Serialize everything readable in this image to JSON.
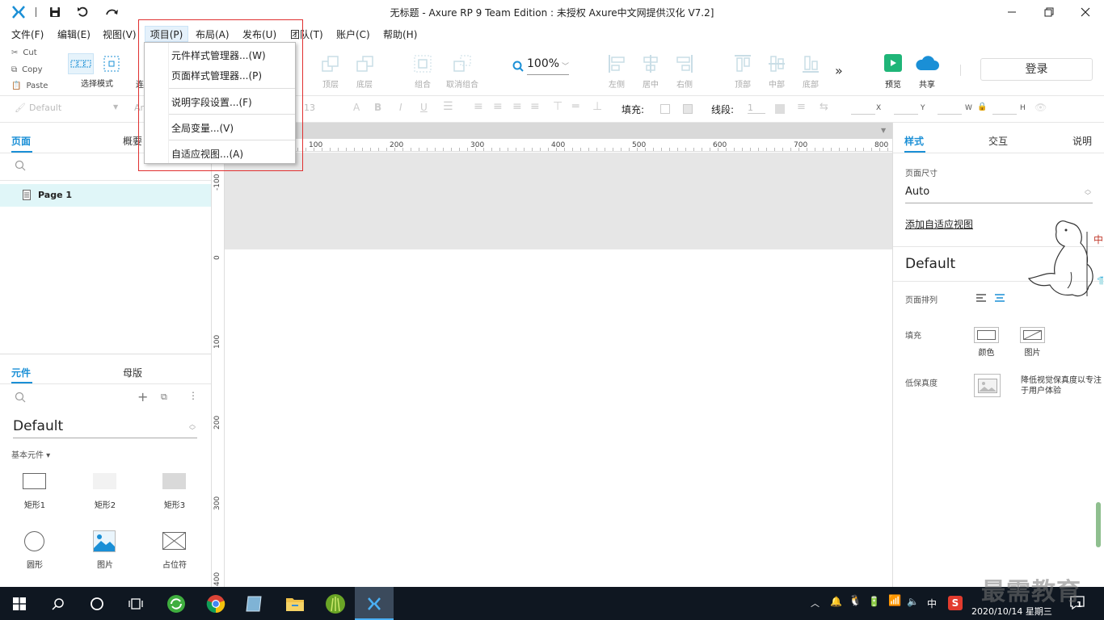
{
  "window": {
    "title": "无标题 - Axure RP 9 Team Edition : 未授权     Axure中文网提供汉化 V7.2]"
  },
  "menu": {
    "items": [
      "文件(F)",
      "编辑(E)",
      "视图(V)",
      "项目(P)",
      "布局(A)",
      "发布(U)",
      "团队(T)",
      "账户(C)",
      "帮助(H)"
    ]
  },
  "project_menu": {
    "items": [
      "元件样式管理器...(W)",
      "页面样式管理器...(P)",
      "说明字段设置...(F)",
      "全局变量...(V)",
      "自适应视图...(A)"
    ]
  },
  "toolbar": {
    "clipboard": [
      "Cut",
      "Copy",
      "Paste"
    ],
    "select_mode": "选择模式",
    "top_layer": "顶层",
    "bottom_layer": "底层",
    "group": "组合",
    "ungroup": "取消组合",
    "zoom": "100%",
    "align": [
      "左侧",
      "居中",
      "右侧",
      "顶部",
      "中部",
      "底部"
    ],
    "preview": "预览",
    "share": "共享",
    "login": "登录"
  },
  "format_bar": {
    "style_select": "Default",
    "font_size": "13",
    "fill_label": "填充:",
    "line_label": "线段:",
    "line_value": "1",
    "coord_labels": [
      "X",
      "Y",
      "W",
      "H"
    ]
  },
  "left_panel": {
    "pages_tabs": [
      "页面",
      "概要"
    ],
    "page_item": "Page 1",
    "widgets_tabs": [
      "元件",
      "母版"
    ],
    "library": "Default",
    "category": "基本元件 ▾",
    "widgets": [
      {
        "label": "矩形1",
        "icon": "rect-outline-icon"
      },
      {
        "label": "矩形2",
        "icon": "rect-light-icon"
      },
      {
        "label": "矩形3",
        "icon": "rect-gray-icon"
      },
      {
        "label": "圆形",
        "icon": "circle-icon"
      },
      {
        "label": "图片",
        "icon": "image-icon"
      },
      {
        "label": "占位符",
        "icon": "placeholder-icon"
      }
    ]
  },
  "ruler": {
    "top": [
      "100",
      "200",
      "300",
      "400",
      "500",
      "600",
      "700",
      "800"
    ],
    "left": [
      "-100",
      "0",
      "100",
      "200",
      "300",
      "400"
    ]
  },
  "right_panel": {
    "tabs": [
      "样式",
      "交互",
      "说明"
    ],
    "page_size_label": "页面尺寸",
    "page_size_value": "Auto",
    "adaptive_link": "添加自适应视图",
    "style_name": "Default",
    "page_align_label": "页面排列",
    "fill_label": "填充",
    "fill_color": "颜色",
    "fill_image": "图片",
    "low_fidelity_label": "低保真度",
    "low_fidelity_desc": "降低视觉保真度以专注于用户体验"
  },
  "taskbar": {
    "ime": "中",
    "datetime": "2020/10/14 星期三",
    "notification_count": "1"
  },
  "watermark": "最需教育",
  "colors": {
    "accent": "#1a8fd6",
    "page_selected_bg": "#e0f6f8",
    "taskbar_bg": "#0f1721",
    "highlight_box": "#e03030",
    "preview_green": "#1fb578"
  }
}
